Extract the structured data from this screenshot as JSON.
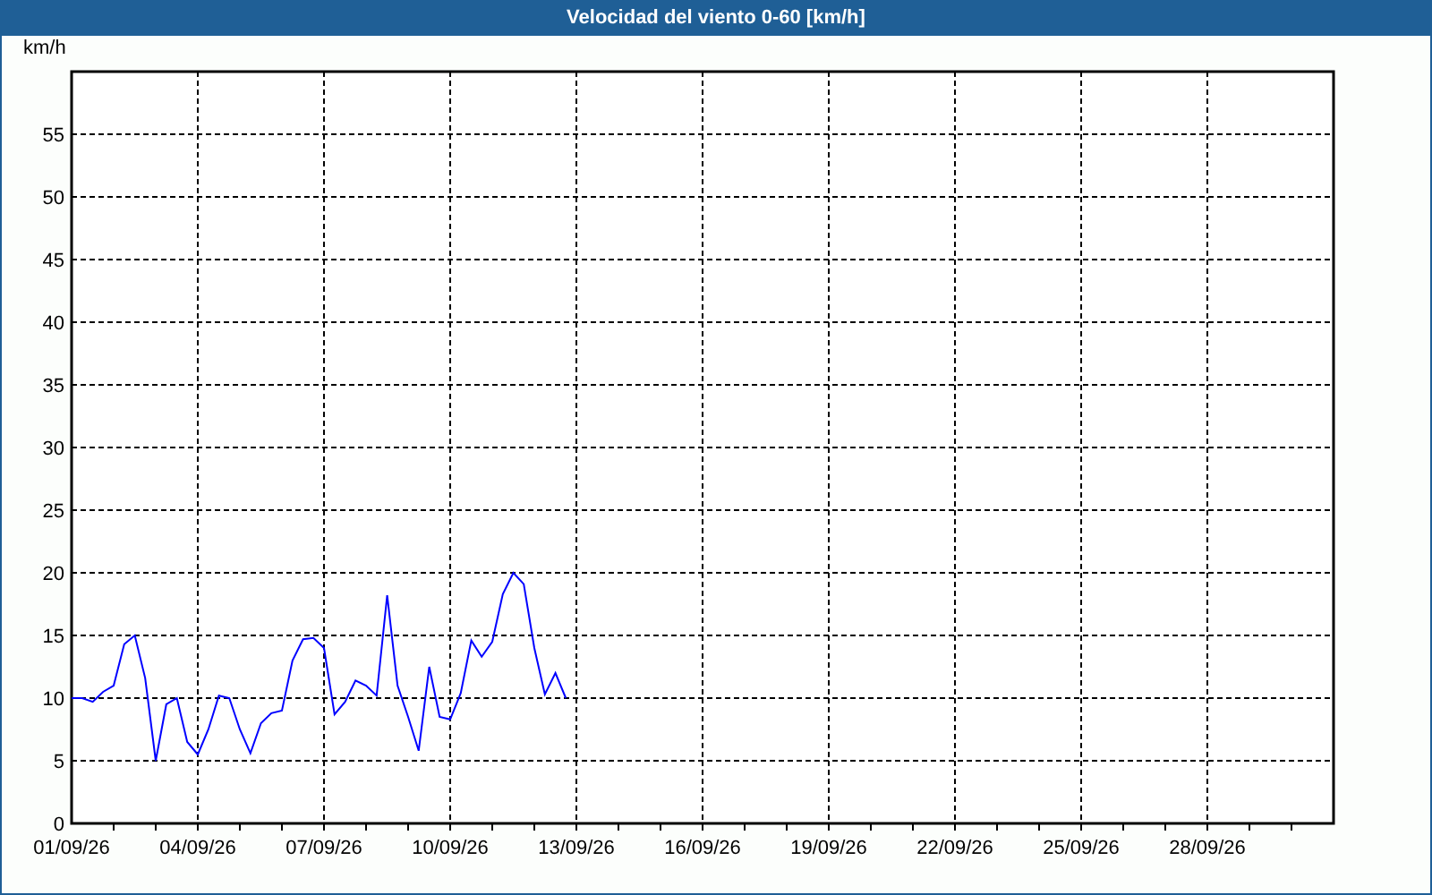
{
  "chart_data": {
    "type": "line",
    "title": "Velocidad del viento 0-60 [km/h]",
    "ylabel": "km/h",
    "grid": true,
    "ylim": [
      0,
      60
    ],
    "yticks": [
      0,
      5,
      10,
      15,
      20,
      25,
      30,
      35,
      40,
      45,
      50,
      55
    ],
    "categories": [
      "01/09/26",
      null,
      null,
      null,
      null,
      null,
      null,
      null,
      null,
      null,
      null,
      null,
      "04/09/26",
      null,
      null,
      null,
      null,
      null,
      null,
      null,
      null,
      null,
      null,
      null,
      "07/09/26",
      null,
      null,
      null,
      null,
      null,
      null,
      null,
      null,
      null,
      null,
      null,
      "10/09/26",
      null,
      null,
      null,
      null,
      null,
      null,
      null,
      null,
      null,
      null,
      null,
      "13/09/26",
      null,
      null,
      null,
      null,
      null,
      null,
      null,
      null,
      null,
      null,
      null,
      "16/09/26",
      null,
      null,
      null,
      null,
      null,
      null,
      null,
      null,
      null,
      null,
      null,
      "19/09/26",
      null,
      null,
      null,
      null,
      null,
      null,
      null,
      null,
      null,
      null,
      null,
      "22/09/26",
      null,
      null,
      null,
      null,
      null,
      null,
      null,
      null,
      null,
      null,
      null,
      "25/09/26",
      null,
      null,
      null,
      null,
      null,
      null,
      null,
      null,
      null,
      null,
      null,
      "28/09/26",
      null,
      null,
      null,
      null,
      null,
      null,
      null,
      null,
      null,
      null,
      null,
      null
    ],
    "values": [
      10,
      10,
      9.7,
      10.5,
      11,
      14.3,
      15,
      11.6,
      5,
      9.5,
      10,
      6.5,
      5.5,
      7.5,
      10.2,
      10,
      7.5,
      5.6,
      8,
      8.8,
      9,
      13,
      14.7,
      14.8,
      14,
      8.7,
      9.7,
      11.4,
      11,
      10.2,
      18.2,
      11,
      8.5,
      5.8,
      12.5,
      8.5,
      8.3,
      10.4,
      14.6,
      13.3,
      14.5,
      18.3,
      20,
      19.1,
      14,
      10.3,
      12,
      10,
      null,
      null,
      null,
      null,
      null,
      null,
      null,
      null,
      null,
      null,
      null,
      null,
      null,
      null,
      null,
      null,
      null,
      null,
      null,
      null,
      null,
      null,
      null,
      null,
      null,
      null,
      null,
      null,
      null,
      null,
      null,
      null,
      null,
      null,
      null,
      null,
      null,
      null,
      null,
      null,
      null,
      null,
      null,
      null,
      null,
      null,
      null,
      null,
      null,
      null,
      null,
      null,
      null,
      null,
      null,
      null,
      null,
      null,
      null,
      null,
      null,
      null,
      null,
      null,
      null,
      null,
      null,
      null,
      null,
      null,
      null,
      null,
      null
    ]
  }
}
